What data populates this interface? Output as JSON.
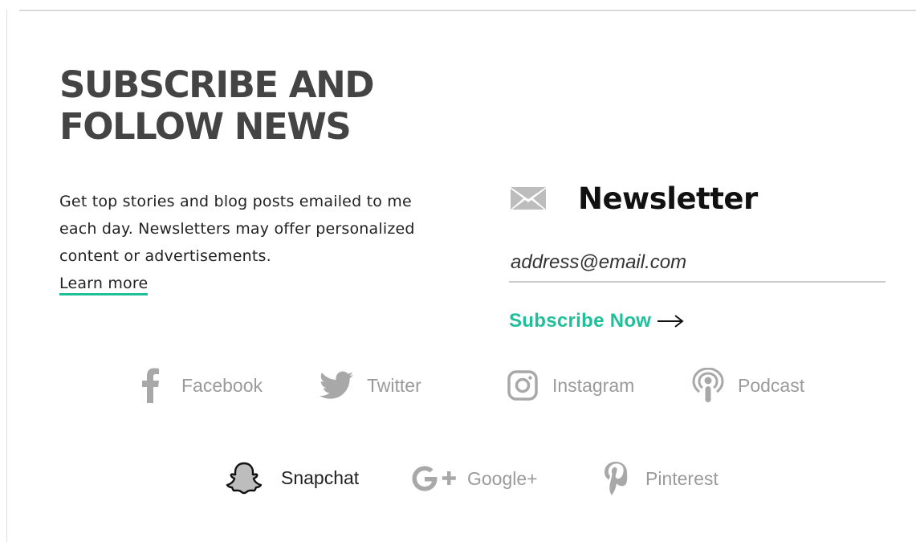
{
  "section": {
    "title_line1": "SUBSCRIBE AND",
    "title_line2": "FOLLOW NEWS",
    "blurb": "Get top stories and blog posts emailed to me each day. Newsletters may offer personalized content or advertisements.",
    "learn_more": "Learn more"
  },
  "newsletter": {
    "icon": "envelope-icon",
    "title": "Newsletter",
    "email_placeholder": "address@email.com",
    "subscribe_label": "Subscribe Now",
    "arrow_icon": "arrow-right-icon"
  },
  "colors": {
    "accent": "#1fbf9a",
    "heading": "#444444",
    "muted": "#9a9a9a"
  },
  "social": {
    "row1": [
      {
        "label": "Facebook",
        "icon": "facebook-icon"
      },
      {
        "label": "Twitter",
        "icon": "twitter-icon"
      },
      {
        "label": "Instagram",
        "icon": "instagram-icon"
      },
      {
        "label": "Podcast",
        "icon": "podcast-icon"
      }
    ],
    "row2": [
      {
        "label": "Snapchat",
        "icon": "snapchat-icon"
      },
      {
        "label": "Google+",
        "icon": "google-plus-icon"
      },
      {
        "label": "Pinterest",
        "icon": "pinterest-icon"
      }
    ]
  }
}
